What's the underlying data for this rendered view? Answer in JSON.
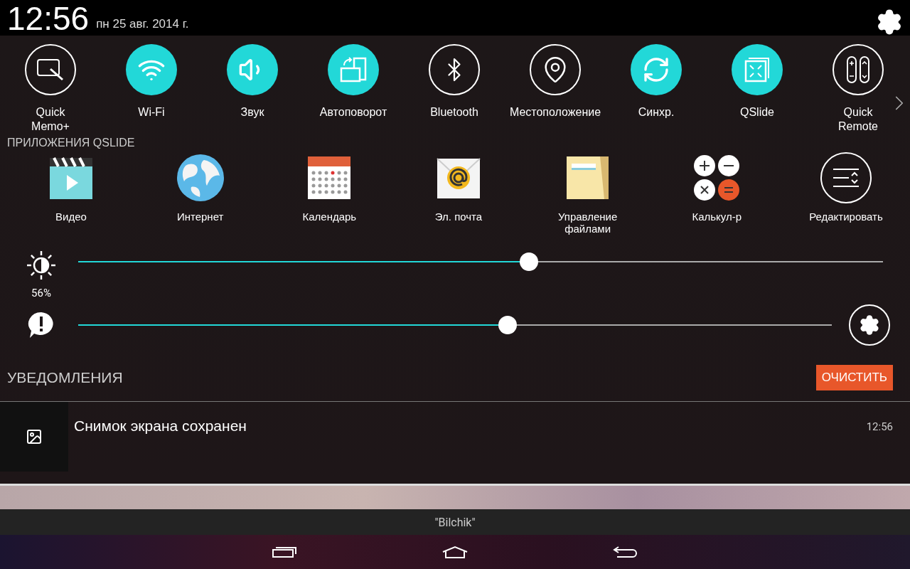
{
  "status_bar": {
    "time": "12:56",
    "date": "пн 25 авг. 2014 г."
  },
  "quick_settings": [
    {
      "kind": "memo",
      "label": "Quick\nMemo+",
      "on": false
    },
    {
      "kind": "wifi",
      "label": "Wi-Fi",
      "on": true
    },
    {
      "kind": "sound",
      "label": "Звук",
      "on": true
    },
    {
      "kind": "rotate",
      "label": "Автоповорот",
      "on": true
    },
    {
      "kind": "bluetooth",
      "label": "Bluetooth",
      "on": false
    },
    {
      "kind": "location",
      "label": "Местоположение",
      "on": false
    },
    {
      "kind": "sync",
      "label": "Синхр.",
      "on": true
    },
    {
      "kind": "qslide",
      "label": "QSlide",
      "on": true
    },
    {
      "kind": "remote",
      "label": "Quick\nRemote",
      "on": false
    }
  ],
  "qslide_apps": {
    "title": "ПРИЛОЖЕНИЯ QSLIDE",
    "items": [
      {
        "kind": "video",
        "label": "Видео"
      },
      {
        "kind": "internet",
        "label": "Интернет"
      },
      {
        "kind": "calendar",
        "label": "Календарь"
      },
      {
        "kind": "email",
        "label": "Эл. почта"
      },
      {
        "kind": "files",
        "label": "Управление\nфайлами"
      },
      {
        "kind": "calculator",
        "label": "Калькул-р"
      },
      {
        "kind": "edit",
        "label": "Редактировать"
      }
    ]
  },
  "brightness": {
    "level": 0.56,
    "reading": "56%"
  },
  "notification_volume": {
    "level": 0.57
  },
  "notifications": {
    "title": "УВЕДОМЛЕНИЯ",
    "clear_button": "ОЧИСТИТЬ",
    "items": [
      {
        "text": "Снимок экрана сохранен",
        "time": "12:56"
      }
    ]
  },
  "toast": "\"Bilchik\""
}
